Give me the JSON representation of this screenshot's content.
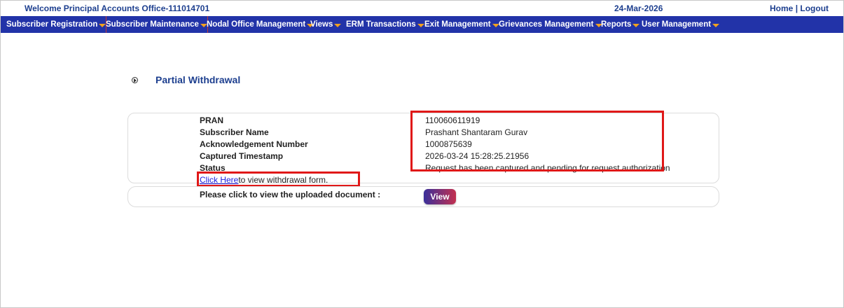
{
  "header": {
    "welcome": "Welcome Principal Accounts Office-111014701",
    "date": "24-Mar-2026",
    "home": "Home",
    "separator": "|",
    "logout": "Logout"
  },
  "nav": {
    "items": [
      "Subscriber Registration",
      "Subscriber Maintenance",
      "Nodal Office Management",
      "Views",
      "ERM Transactions",
      "Exit Management",
      "Grievances Management",
      "Reports",
      "User Management"
    ]
  },
  "page": {
    "title": "Partial Withdrawal"
  },
  "details": {
    "pran_label": "PRAN",
    "pran_value": "110060611919",
    "name_label": "Subscriber Name",
    "name_value": "Prashant Shantaram Gurav",
    "ack_label": "Acknowledgement Number",
    "ack_value": "1000875639",
    "ts_label": "Captured Timestamp",
    "ts_value": "2026-03-24 15:28:25.21956",
    "status_label": "Status",
    "status_value": "Request has been captured and pending for request authorization"
  },
  "form_link": {
    "link_text": "Click Here",
    "suffix": "to view withdrawal form."
  },
  "document": {
    "label": "Please click to view the uploaded document :",
    "button": "View"
  },
  "colors": {
    "nav_bg": "#2233a8",
    "header_text": "#1d3f8f",
    "highlight": "#e01818"
  }
}
